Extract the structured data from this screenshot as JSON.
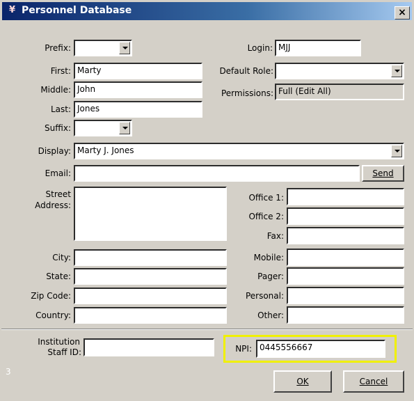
{
  "window": {
    "title": "Personnel Database",
    "close_glyph": "×"
  },
  "form": {
    "prefix": {
      "label": "Prefix:",
      "value": ""
    },
    "first": {
      "label": "First:",
      "value": "Marty"
    },
    "middle": {
      "label": "Middle:",
      "value": "John"
    },
    "last": {
      "label": "Last:",
      "value": "Jones"
    },
    "suffix": {
      "label": "Suffix:",
      "value": ""
    },
    "display": {
      "label": "Display:",
      "value": "Marty J. Jones"
    },
    "email": {
      "label": "Email:",
      "value": ""
    },
    "login": {
      "label": "Login:",
      "value": "MJJ"
    },
    "default_role": {
      "label": "Default Role:",
      "value": ""
    },
    "permissions": {
      "label": "Permissions:",
      "value": "Full (Edit All)"
    },
    "street": {
      "label_line1": "Street",
      "label_line2": "Address:",
      "value": ""
    },
    "city": {
      "label": "City:",
      "value": ""
    },
    "state": {
      "label": "State:",
      "value": ""
    },
    "zip": {
      "label": "Zip Code:",
      "value": ""
    },
    "country": {
      "label": "Country:",
      "value": ""
    },
    "office1": {
      "label": "Office 1:",
      "value": ""
    },
    "office2": {
      "label": "Office 2:",
      "value": ""
    },
    "fax": {
      "label": "Fax:",
      "value": ""
    },
    "mobile": {
      "label": "Mobile:",
      "value": ""
    },
    "pager": {
      "label": "Pager:",
      "value": ""
    },
    "personal": {
      "label": "Personal:",
      "value": ""
    },
    "other": {
      "label": "Other:",
      "value": ""
    },
    "institution": {
      "label_line1": "Institution",
      "label_line2": "Staff ID:",
      "value": ""
    },
    "npi": {
      "label": "NPI:",
      "value": "0445556667"
    }
  },
  "buttons": {
    "send": "Send",
    "ok": "OK",
    "cancel": "Cancel"
  },
  "footer": {
    "corner_number": "3"
  },
  "colors": {
    "highlight": "#f0f000",
    "title_start": "#0a246a"
  }
}
